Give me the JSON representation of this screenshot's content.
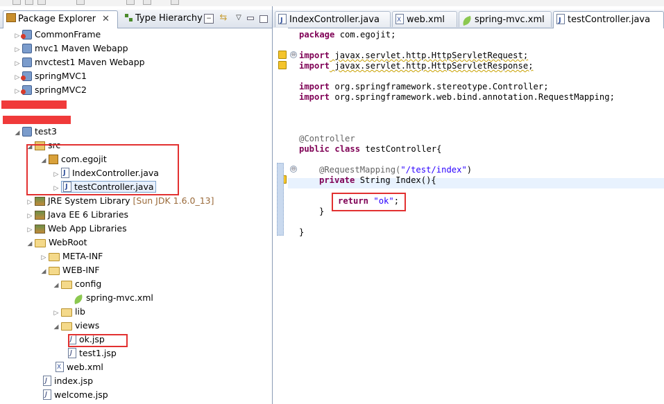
{
  "left_panel": {
    "tabs": [
      {
        "label": "Package Explorer",
        "active": true
      },
      {
        "label": "Type Hierarchy",
        "active": false
      }
    ],
    "tree": [
      {
        "label": "CommonFrame",
        "icon": "project-error-icon"
      },
      {
        "label": "mvc1 Maven Webapp",
        "icon": "project-icon"
      },
      {
        "label": "mvctest1 Maven Webapp",
        "icon": "project-icon"
      },
      {
        "label": "springMVC1",
        "icon": "project-error-icon"
      },
      {
        "label": "springMVC2",
        "icon": "project-error-icon"
      },
      {
        "label": "test3",
        "icon": "project-icon"
      },
      {
        "label": "src",
        "icon": "source-folder-icon"
      },
      {
        "label": "com.egojit",
        "icon": "package-icon"
      },
      {
        "label": "IndexController.java",
        "icon": "java-file-icon"
      },
      {
        "label": "testController.java",
        "icon": "java-file-icon"
      },
      {
        "label": "JRE System Library",
        "suffix": "[Sun JDK 1.6.0_13]",
        "icon": "library-icon"
      },
      {
        "label": "Java EE 6 Libraries",
        "icon": "library-icon"
      },
      {
        "label": "Web App Libraries",
        "icon": "library-icon"
      },
      {
        "label": "WebRoot",
        "icon": "folder-icon"
      },
      {
        "label": "META-INF",
        "icon": "folder-icon"
      },
      {
        "label": "WEB-INF",
        "icon": "folder-icon"
      },
      {
        "label": "config",
        "icon": "folder-icon"
      },
      {
        "label": "spring-mvc.xml",
        "icon": "spring-leaf-icon"
      },
      {
        "label": "lib",
        "icon": "folder-icon"
      },
      {
        "label": "views",
        "icon": "folder-icon"
      },
      {
        "label": "ok.jsp",
        "icon": "jsp-file-icon"
      },
      {
        "label": "test1.jsp",
        "icon": "jsp-file-icon"
      },
      {
        "label": "web.xml",
        "icon": "xml-file-icon"
      },
      {
        "label": "index.jsp",
        "icon": "jsp-file-icon"
      },
      {
        "label": "welcome.jsp",
        "icon": "jsp-file-icon"
      }
    ]
  },
  "editor": {
    "tabs": [
      {
        "label": "IndexController.java",
        "icon": "java-file-icon",
        "active": false
      },
      {
        "label": "web.xml",
        "icon": "xml-file-icon",
        "active": false
      },
      {
        "label": "spring-mvc.xml",
        "icon": "spring-leaf-icon",
        "active": false
      },
      {
        "label": "testController.java",
        "icon": "java-file-icon",
        "active": true
      }
    ],
    "code": {
      "l1_kw": "package",
      "l1_rest": " com.egojit;",
      "l2_kw": "import",
      "l2_rest": " javax.servlet.http.HttpServletRequest;",
      "l3_kw": "import",
      "l3_rest": " javax.servlet.http.HttpServletResponse;",
      "l4_kw": "import",
      "l4_rest": " org.springframework.stereotype.Controller;",
      "l5_kw": "import",
      "l5_rest": " org.springframework.web.bind.annotation.RequestMapping;",
      "l6_ann": "@Controller",
      "l7_kw1": "public",
      "l7_kw2": "class",
      "l7_rest": " testController{",
      "l8_ann": "@RequestMapping(",
      "l8_str": "\"/test/index\"",
      "l8_end": ")",
      "l9_kw": "private",
      "l9_rest": " String Index(){",
      "l10_kw": "return",
      "l10_str": "\"ok\"",
      "l10_end": ";",
      "l11": "}",
      "l12": "}"
    }
  }
}
